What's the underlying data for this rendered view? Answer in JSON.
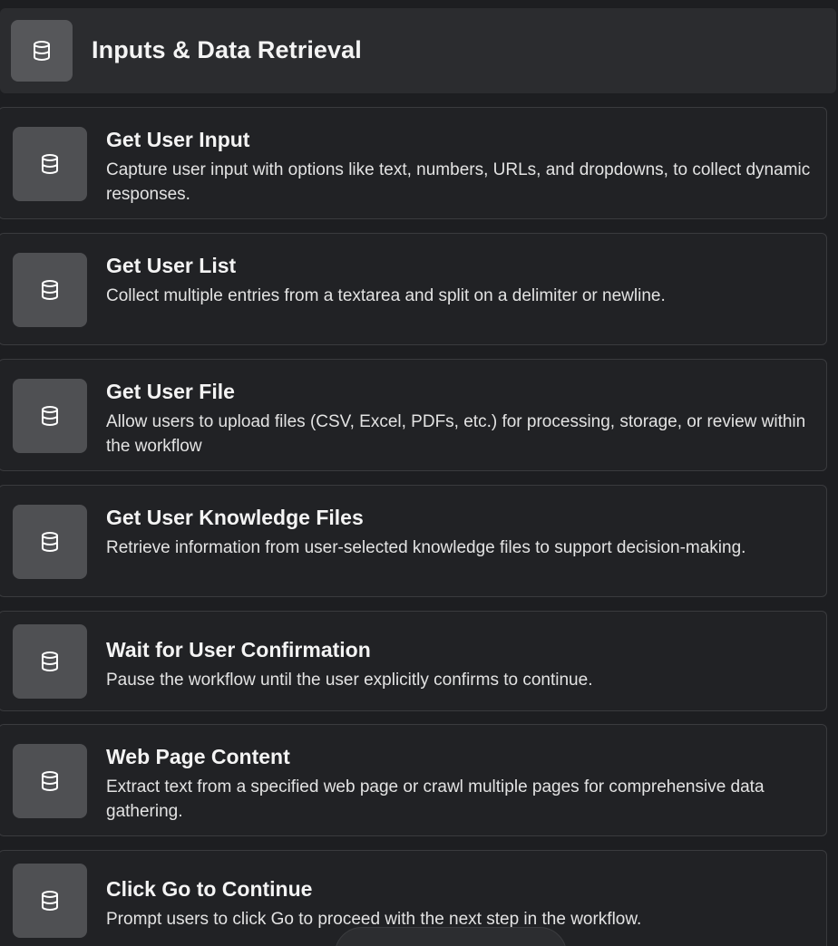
{
  "header": {
    "title": "Inputs & Data Retrieval",
    "icon": "database-icon"
  },
  "cards": [
    {
      "title": "Get User Input",
      "description": "Capture user input with options like text, numbers, URLs, and dropdowns, to collect dynamic responses.",
      "icon": "database-icon"
    },
    {
      "title": "Get User List",
      "description": "Collect multiple entries from a textarea and split on a delimiter or newline.",
      "icon": "database-icon"
    },
    {
      "title": "Get User File",
      "description": "Allow users to upload files (CSV, Excel, PDFs, etc.) for processing, storage, or review within the workflow",
      "icon": "database-icon"
    },
    {
      "title": "Get User Knowledge Files",
      "description": "Retrieve information from user-selected knowledge files to support decision-making.",
      "icon": "database-icon"
    },
    {
      "title": "Wait for User Confirmation",
      "description": "Pause the workflow until the user explicitly confirms to continue.",
      "icon": "database-icon"
    },
    {
      "title": "Web Page Content",
      "description": "Extract text from a specified web page or crawl multiple pages for comprehensive data gathering.",
      "icon": "database-icon"
    },
    {
      "title": "Click Go to Continue",
      "description": "Prompt users to click Go to proceed with the next step in the workflow.",
      "icon": "database-icon"
    }
  ],
  "colors": {
    "background": "#1d1e21",
    "card": "#212225",
    "icon_tile": "#4f5053",
    "text": "#f4f4f4"
  }
}
